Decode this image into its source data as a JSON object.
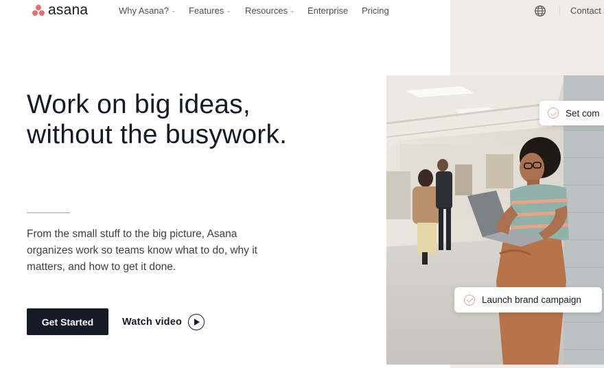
{
  "brand": {
    "name": "asana",
    "color": "#f06a6a"
  },
  "nav": {
    "items": [
      {
        "label": "Why Asana?",
        "dropdown": true
      },
      {
        "label": "Features",
        "dropdown": true
      },
      {
        "label": "Resources",
        "dropdown": true
      },
      {
        "label": "Enterprise",
        "dropdown": false
      },
      {
        "label": "Pricing",
        "dropdown": false
      }
    ],
    "caret": "⌄",
    "globe_icon": "globe-icon",
    "contact_label": "Contact"
  },
  "hero": {
    "headline_line1": "Work on big ideas,",
    "headline_line2": "without the busywork.",
    "subtext": "From the small stuff to the big picture, Asana organizes work so teams know what to do, why it matters, and how to get it done.",
    "cta_primary": "Get Started",
    "cta_secondary": "Watch video"
  },
  "photo_cards": {
    "top": "Set com",
    "bottom": "Launch brand campaign"
  }
}
